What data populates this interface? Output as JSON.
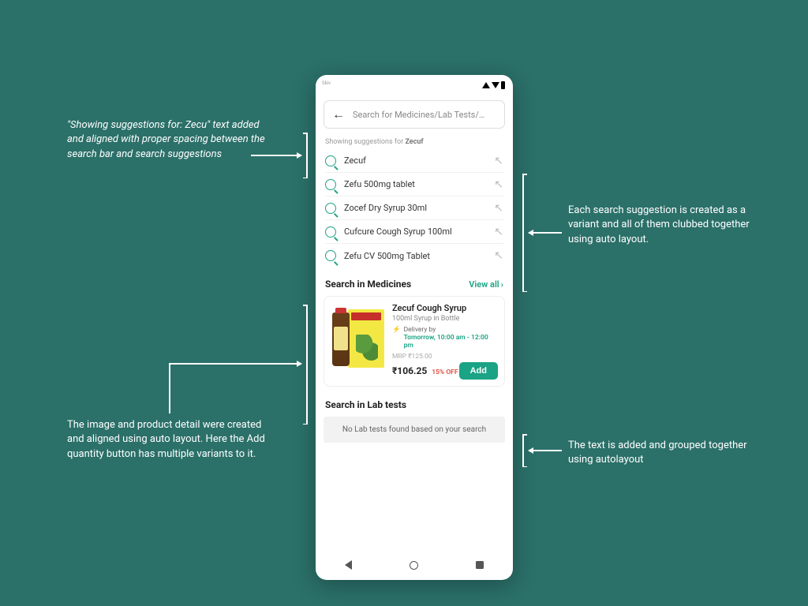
{
  "annotations": {
    "top_left": "\"Showing suggestions for: Zecu\" text added and aligned with proper spacing between the search bar and search suggestions",
    "mid_right": "Each search suggestion is created as a variant and all of them clubbed together using auto layout.",
    "bottom_left": "The image and product detail were created and aligned using auto layout. Here the Add quantity button has multiple variants to it.",
    "bottom_right": "The text is added and grouped together using autolayout"
  },
  "carrier": "Skiv",
  "search_placeholder": "Search for Medicines/Lab Tests/…",
  "suggest_prefix": "Showing suggestions for ",
  "suggest_term": "Zecuf",
  "suggestions": [
    "Zecuf",
    "Zefu 500mg tablet",
    "Zocef Dry Syrup 30ml",
    "Cufcure Cough Syrup 100ml",
    "Zefu CV 500mg Tablet"
  ],
  "medicines": {
    "title": "Search in Medicines",
    "view_all": "View all"
  },
  "product": {
    "name": "Zecuf Cough Syrup",
    "sub": "100ml Syrup in Bottle",
    "delivery_label": "Delivery by",
    "delivery_time": "Tomorrow, 10:00 am - 12:00 pm",
    "mrp": "MRP ₹125.00",
    "price": "₹106.25",
    "discount": "15% OFF",
    "add": "Add"
  },
  "lab": {
    "title": "Search in Lab tests",
    "empty": "No Lab tests found based on your search"
  }
}
